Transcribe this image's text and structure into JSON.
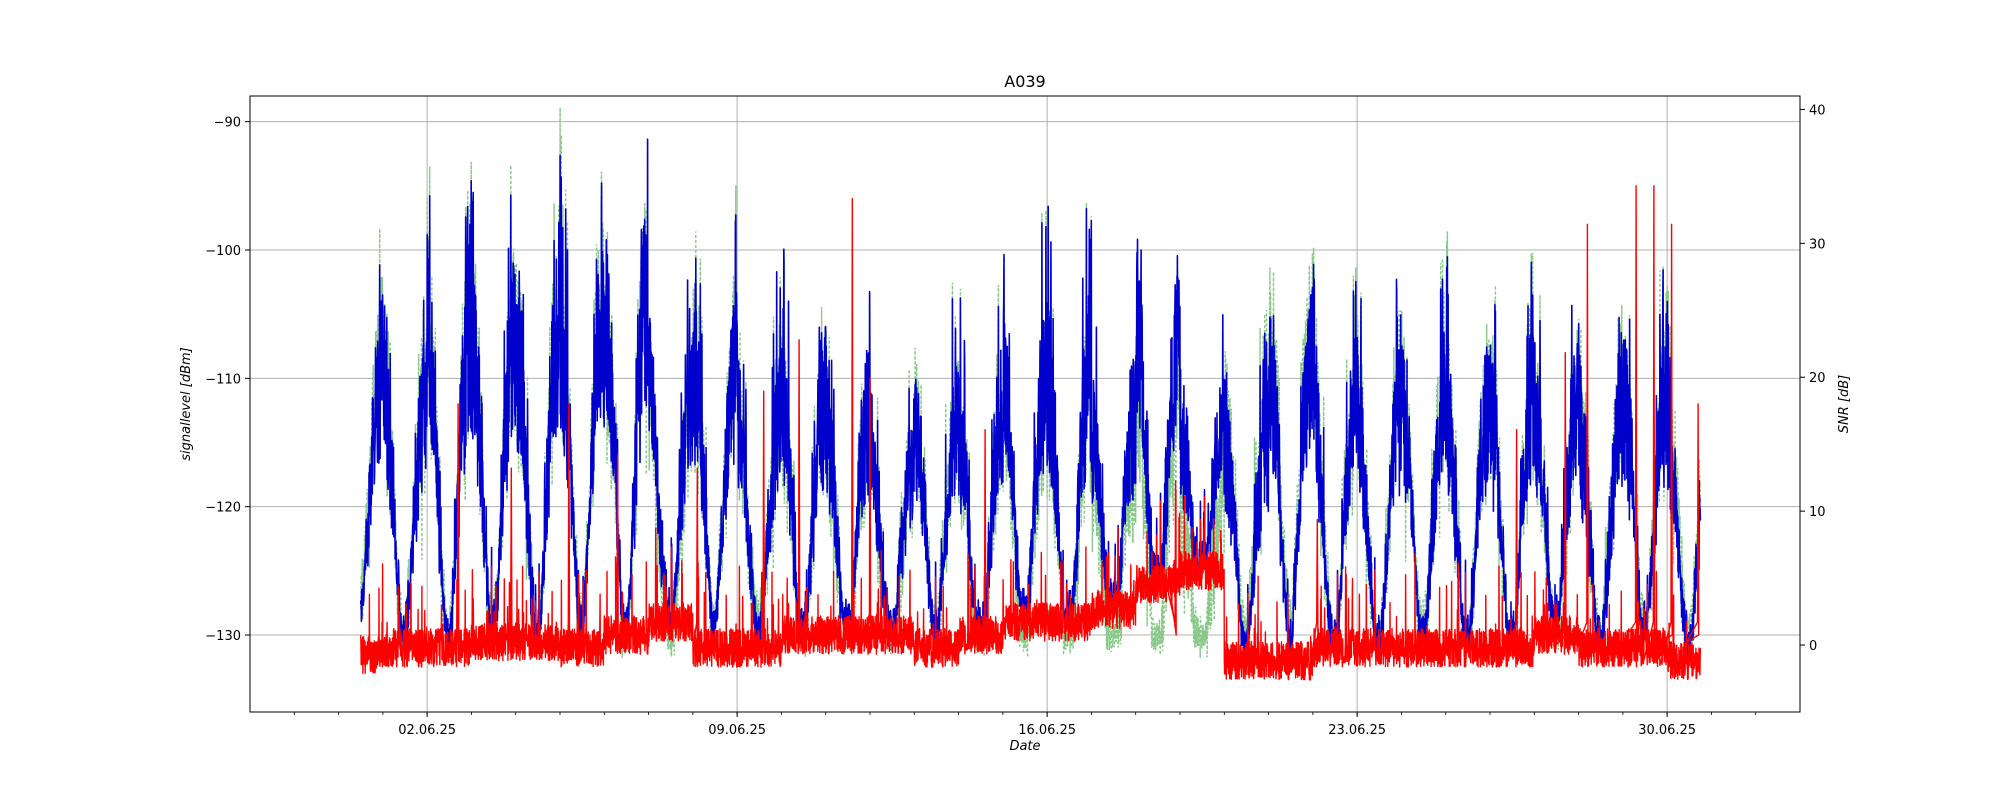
{
  "chart_data": {
    "type": "line",
    "title": "A039",
    "xlabel": "Date",
    "ylabel_left": "signallevel [dBm]",
    "ylabel_right": "SNR [dB]",
    "x_range": [
      "2025-05-29",
      "2025-07-03"
    ],
    "x_ticks": [
      {
        "date": "2025-06-02",
        "label": "02.06.25"
      },
      {
        "date": "2025-06-09",
        "label": "09.06.25"
      },
      {
        "date": "2025-06-16",
        "label": "16.06.25"
      },
      {
        "date": "2025-06-23",
        "label": "23.06.25"
      },
      {
        "date": "2025-06-30",
        "label": "30.06.25"
      }
    ],
    "ylim_left": [
      -136,
      -88
    ],
    "yticks_left": [
      {
        "value": -90,
        "label": "−90"
      },
      {
        "value": -100,
        "label": "−100"
      },
      {
        "value": -110,
        "label": "−110"
      },
      {
        "value": -120,
        "label": "−120"
      },
      {
        "value": -130,
        "label": "−130"
      }
    ],
    "ylim_right": [
      -5,
      41
    ],
    "yticks_right": [
      {
        "value": 0,
        "label": "0"
      },
      {
        "value": 10,
        "label": "10"
      },
      {
        "value": 20,
        "label": "20"
      },
      {
        "value": 30,
        "label": "30"
      },
      {
        "value": 40,
        "label": "40"
      }
    ],
    "grid": true,
    "data_range": [
      "2025-05-31T12:00",
      "2025-06-30T18:00"
    ],
    "series": [
      {
        "axis": "left",
        "style": "solid",
        "color": "#0000cc",
        "daily_peaks": [
          -101,
          -103,
          -93,
          -95,
          -94,
          -94,
          -90,
          -101,
          -98,
          -103,
          -101,
          -104,
          -110,
          -104,
          -105,
          -99,
          -98,
          -105,
          -94,
          -106,
          -106,
          -98,
          -102,
          -103,
          -103,
          -102,
          -102,
          -103,
          -104,
          -102,
          -105
        ],
        "daily_floor": [
          -128,
          -130,
          -131,
          -130,
          -131,
          -129,
          -130,
          -130,
          -129,
          -130,
          -131,
          -131,
          -130,
          -130,
          -131,
          -130,
          -131,
          -130,
          -129,
          -128,
          -131,
          -130,
          -131,
          -131,
          -130,
          -131,
          -131,
          -130,
          -131,
          -130,
          -131
        ]
      },
      {
        "axis": "left",
        "style": "solid",
        "color": "#ff0000",
        "daily_base": [
          -131.5,
          -131,
          -131,
          -130.5,
          -130.5,
          -131,
          -130,
          -129,
          -131,
          -131,
          -130,
          -130,
          -130,
          -131,
          -130,
          -129,
          -129,
          -128,
          -126,
          -125,
          -132,
          -132,
          -131,
          -131,
          -131,
          -131,
          -131,
          -130,
          -131,
          -131,
          -132
        ],
        "spikes": [
          [
            2.2,
            -112
          ],
          [
            3.4,
            -117
          ],
          [
            4.7,
            -112
          ],
          [
            5.8,
            -116
          ],
          [
            7.6,
            -117
          ],
          [
            9.1,
            -111
          ],
          [
            9.9,
            -107
          ],
          [
            11.1,
            -96
          ],
          [
            11.5,
            -110
          ],
          [
            14.1,
            -114
          ],
          [
            18.4,
            -118
          ],
          [
            21.6,
            -121
          ],
          [
            26.1,
            -114
          ],
          [
            27.2,
            -108
          ],
          [
            27.7,
            -98
          ],
          [
            28.8,
            -95
          ],
          [
            29.2,
            -95
          ],
          [
            29.6,
            -98
          ],
          [
            30.2,
            -112
          ]
        ]
      },
      {
        "axis": "right",
        "style": "dotted",
        "color": "#88c888",
        "values_follow": "signallevel"
      }
    ]
  }
}
